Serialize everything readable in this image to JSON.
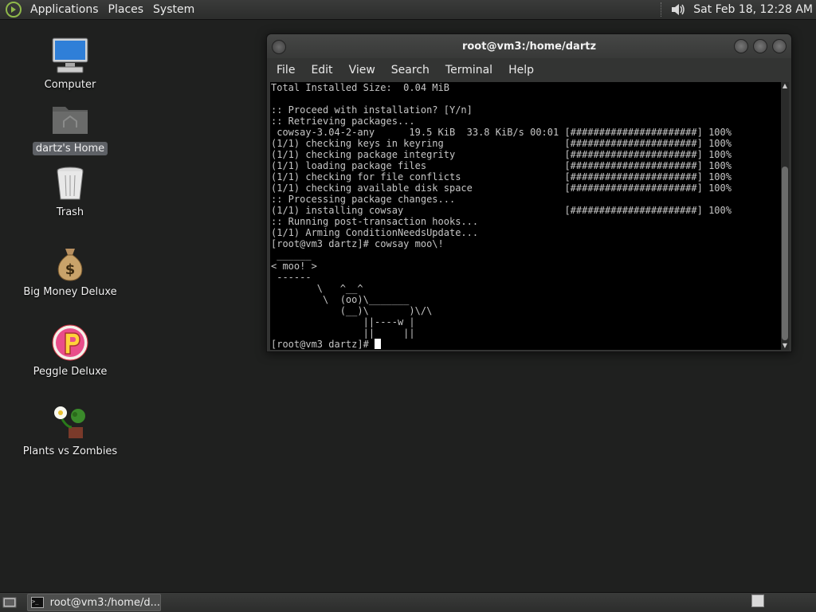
{
  "top_panel": {
    "menus": [
      "Applications",
      "Places",
      "System"
    ],
    "clock": "Sat Feb 18, 12:28 AM",
    "icons": [
      "distro-logo-icon",
      "volume-icon"
    ]
  },
  "desktop": {
    "icons": [
      {
        "label": "Computer",
        "icon": "computer-icon",
        "selected": false
      },
      {
        "label": "dartz's Home",
        "icon": "home-folder-icon",
        "selected": true
      },
      {
        "label": "Trash",
        "icon": "trash-icon",
        "selected": false
      },
      {
        "label": "Big Money Deluxe",
        "icon": "money-bag-icon",
        "selected": false
      },
      {
        "label": "Peggle Deluxe",
        "icon": "peggle-icon",
        "selected": false
      },
      {
        "label": "Plants vs Zombies",
        "icon": "plants-icon",
        "selected": false
      }
    ]
  },
  "terminal": {
    "title": "root@vm3:/home/dartz",
    "menu": [
      "File",
      "Edit",
      "View",
      "Search",
      "Terminal",
      "Help"
    ],
    "lines": [
      "Total Installed Size:  0.04 MiB",
      "",
      ":: Proceed with installation? [Y/n]",
      ":: Retrieving packages...",
      " cowsay-3.04-2-any      19.5 KiB  33.8 KiB/s 00:01 [######################] 100%",
      "(1/1) checking keys in keyring                     [######################] 100%",
      "(1/1) checking package integrity                   [######################] 100%",
      "(1/1) loading package files                        [######################] 100%",
      "(1/1) checking for file conflicts                  [######################] 100%",
      "(1/1) checking available disk space                [######################] 100%",
      ":: Processing package changes...",
      "(1/1) installing cowsay                            [######################] 100%",
      ":: Running post-transaction hooks...",
      "(1/1) Arming ConditionNeedsUpdate...",
      "[root@vm3 dartz]# cowsay moo\\!",
      " ______",
      "< moo! >",
      " ------",
      "        \\   ^__^",
      "         \\  (oo)\\_______",
      "            (__)\\       )\\/\\",
      "                ||----w |",
      "                ||     ||"
    ],
    "prompt": "[root@vm3 dartz]# "
  },
  "bottom_panel": {
    "task_label": "root@vm3:/home/d..."
  },
  "colors": {
    "desktop_bg": "#1f201f",
    "terminal_fg": "#c6c6c6",
    "terminal_bg": "#000000",
    "selection_bg": "#5e6166"
  }
}
